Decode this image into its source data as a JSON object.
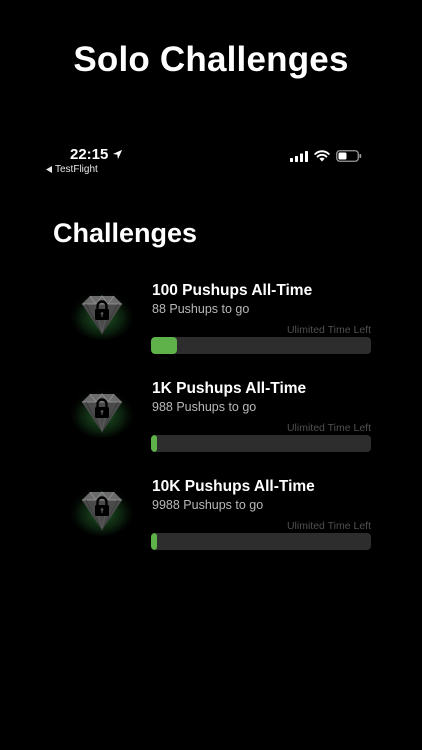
{
  "promo": {
    "title": "Solo Challenges"
  },
  "status_bar": {
    "time": "22:15",
    "back_app": "TestFlight"
  },
  "page": {
    "title": "Challenges"
  },
  "colors": {
    "background": "#000000",
    "progress_fill": "#5fb14a",
    "progress_track": "#2d2d2d",
    "badge_glow": "#3fa84a"
  },
  "challenges": [
    {
      "title": "100 Pushups All-Time",
      "subtitle": "88 Pushups to go",
      "time_left": "Ulimited Time Left",
      "progress": 0.12,
      "icon": "locked-diamond-icon"
    },
    {
      "title": "1K Pushups All-Time",
      "subtitle": "988 Pushups to go",
      "time_left": "Ulimited Time Left",
      "progress": 0.012,
      "icon": "locked-diamond-icon"
    },
    {
      "title": "10K Pushups All-Time",
      "subtitle": "9988 Pushups to go",
      "time_left": "Ulimited Time Left",
      "progress": 0.0012,
      "icon": "locked-diamond-icon"
    }
  ]
}
